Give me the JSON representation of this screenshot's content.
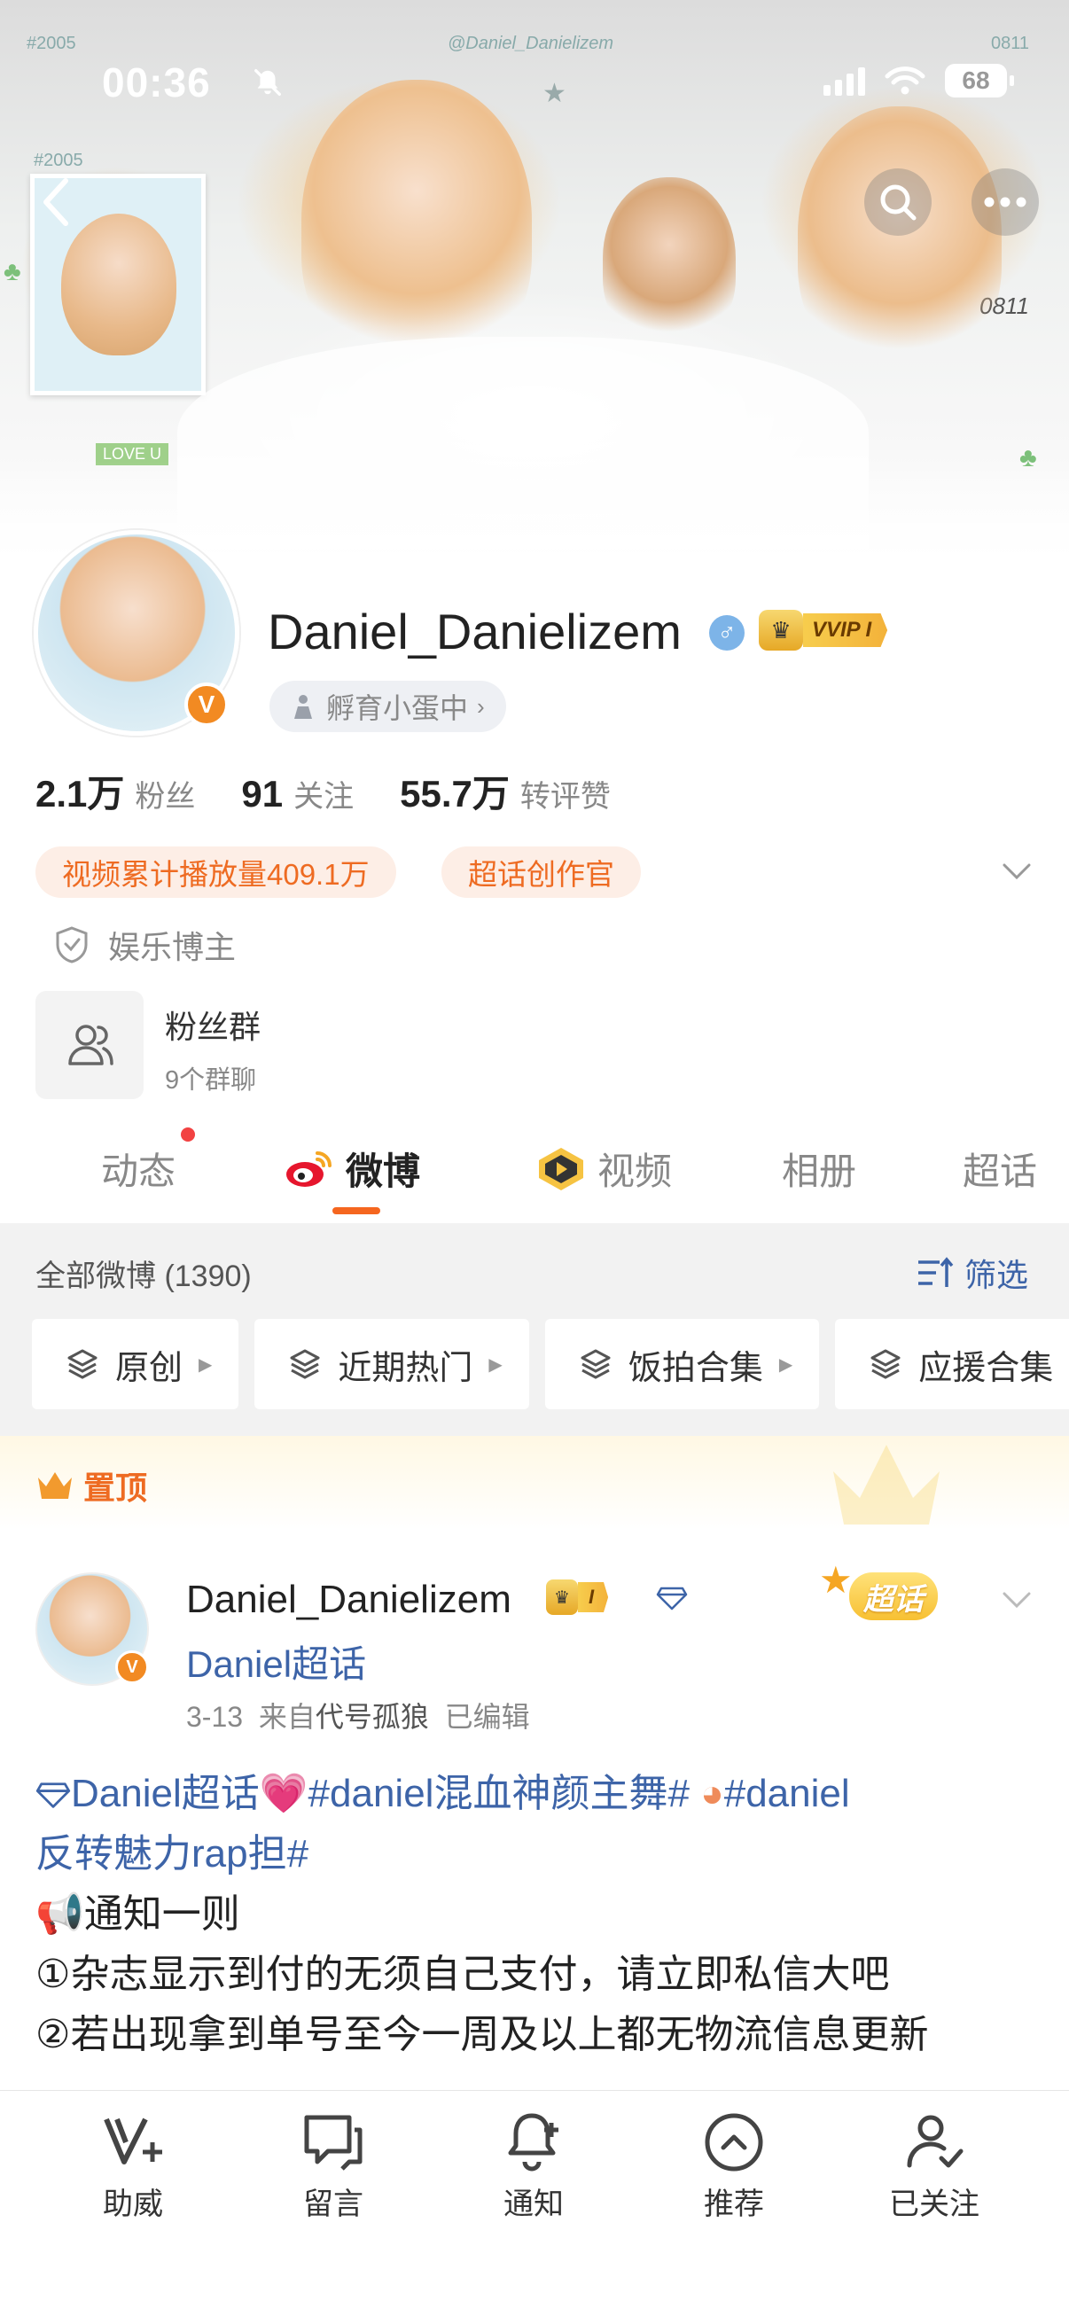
{
  "status_bar": {
    "time": "00:36",
    "battery": "68"
  },
  "banner": {
    "watermark_top_left": "#2005",
    "watermark_center": "@Daniel_Danielizem",
    "watermark_top_right": "0811",
    "polaroid_tag": "#2005",
    "love_tag": "LOVE U",
    "number_tag": "0811",
    "icons": [
      "back-icon",
      "search-icon",
      "more-icon"
    ]
  },
  "profile": {
    "username": "Daniel_Danielizem",
    "gender_icon": "male-icon",
    "vip_label": "VVIP I",
    "hatch_label": "孵育小蛋中",
    "stats": [
      {
        "value": "2.1万",
        "label": "粉丝"
      },
      {
        "value": "91",
        "label": "关注"
      },
      {
        "value": "55.7万",
        "label": "转评赞"
      }
    ],
    "badges": [
      "视频累计播放量409.1万",
      "超话创作官"
    ],
    "category": "娱乐博主",
    "fan_group": {
      "title": "粉丝群",
      "subtitle": "9个群聊"
    }
  },
  "tabs": [
    {
      "label": "动态",
      "has_dot": true
    },
    {
      "label": "微博",
      "active": true
    },
    {
      "label": "视频"
    },
    {
      "label": "相册"
    },
    {
      "label": "超话"
    }
  ],
  "feed": {
    "count_label": "全部微博 (1390)",
    "filter_label": "筛选",
    "chips": [
      "原创",
      "近期热门",
      "饭拍合集",
      "应援合集"
    ],
    "pinned_label": "置顶"
  },
  "post": {
    "user": "Daniel_Danielizem",
    "vip_label": "I",
    "chaohua_link": "Daniel超话",
    "time": "3-13",
    "source_prefix": "来自",
    "source": "代号孤狼",
    "edited": "已编辑",
    "sticker_label": "超话",
    "lines": {
      "l1_tag1": "Daniel超话",
      "l1_tag2": "#daniel混血神颜主舞#",
      "l1_tag3": "#daniel",
      "l2_tag": "反转魅力rap担#",
      "l3": "通知一则",
      "l4": "①杂志显示到付的无须自己支付，请立即私信大吧",
      "l5": "②若出现拿到单号至今一周及以上都无物流信息更新"
    }
  },
  "bottom_bar": [
    {
      "label": "助威",
      "icon": "cheer-icon"
    },
    {
      "label": "留言",
      "icon": "message-icon"
    },
    {
      "label": "通知",
      "icon": "bell-plus-icon"
    },
    {
      "label": "推荐",
      "icon": "recommend-icon"
    },
    {
      "label": "已关注",
      "icon": "followed-icon"
    }
  ],
  "colors": {
    "accent_orange": "#ee6b22",
    "link_blue": "#3d64a8",
    "tab_underline": "#f5661f"
  }
}
